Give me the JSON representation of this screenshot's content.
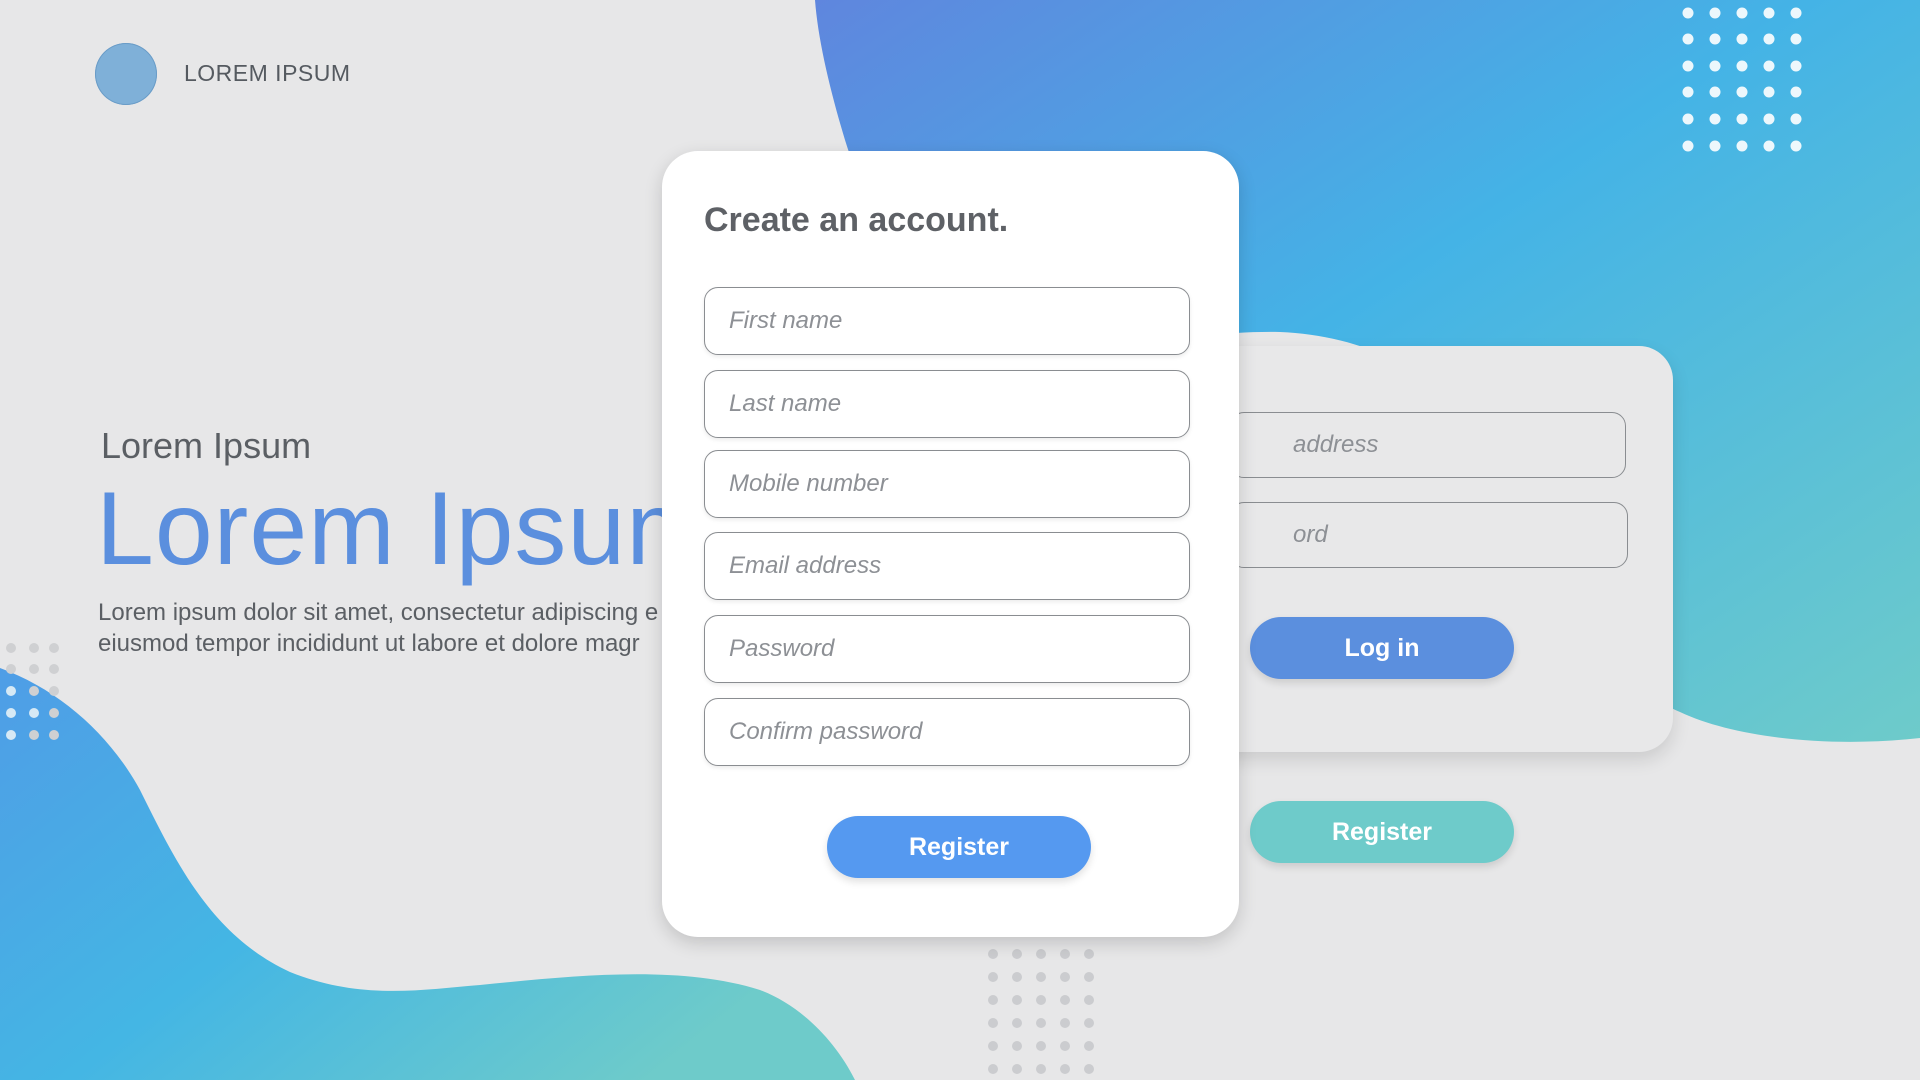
{
  "brand": {
    "name": "LOREM IPSUM",
    "logo_color": "#7fb0d8"
  },
  "hero": {
    "subtitle": "Lorem Ipsum",
    "title": "Lorem Ipsum",
    "body_line1": "Lorem ipsum dolor sit amet, consectetur adipiscing e",
    "body_line2": "eiusmod tempor incididunt ut labore et dolore magr"
  },
  "register_form": {
    "title": "Create an account.",
    "fields": [
      {
        "placeholder": "First name"
      },
      {
        "placeholder": "Last name"
      },
      {
        "placeholder": "Mobile number"
      },
      {
        "placeholder": "Email address"
      },
      {
        "placeholder": "Password"
      },
      {
        "placeholder": "Confirm password"
      }
    ],
    "submit_label": "Register",
    "submit_color": "#5599f0"
  },
  "login_form": {
    "email_placeholder_visible": "address",
    "password_placeholder_visible": "ord",
    "login_label": "Log in",
    "login_color": "#5b8fde",
    "register_label": "Register",
    "register_color": "#6ecbca"
  },
  "theme": {
    "background": "#e7e7e8",
    "gradient_start": "#5b8fde",
    "gradient_mid": "#42b4e6",
    "gradient_end": "#6ecbca"
  }
}
